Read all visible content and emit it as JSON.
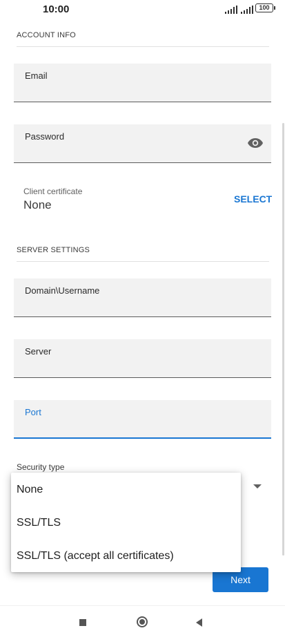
{
  "status_bar": {
    "time": "10:00",
    "battery": "100"
  },
  "account_info": {
    "title": "ACCOUNT INFO",
    "email_label": "Email",
    "password_label": "Password",
    "client_cert_label": "Client certificate",
    "client_cert_value": "None",
    "select_label": "SELECT"
  },
  "server_settings": {
    "title": "SERVER SETTINGS",
    "domain_username_label": "Domain\\Username",
    "server_label": "Server",
    "port_label": "Port",
    "security_type_label": "Security type"
  },
  "security_menu": {
    "options": [
      "None",
      "SSL/TLS",
      "SSL/TLS (accept all certificates)"
    ]
  },
  "next_label": "Next",
  "colors": {
    "accent": "#1976d2"
  },
  "icons": {
    "password_toggle": "eye-icon"
  }
}
